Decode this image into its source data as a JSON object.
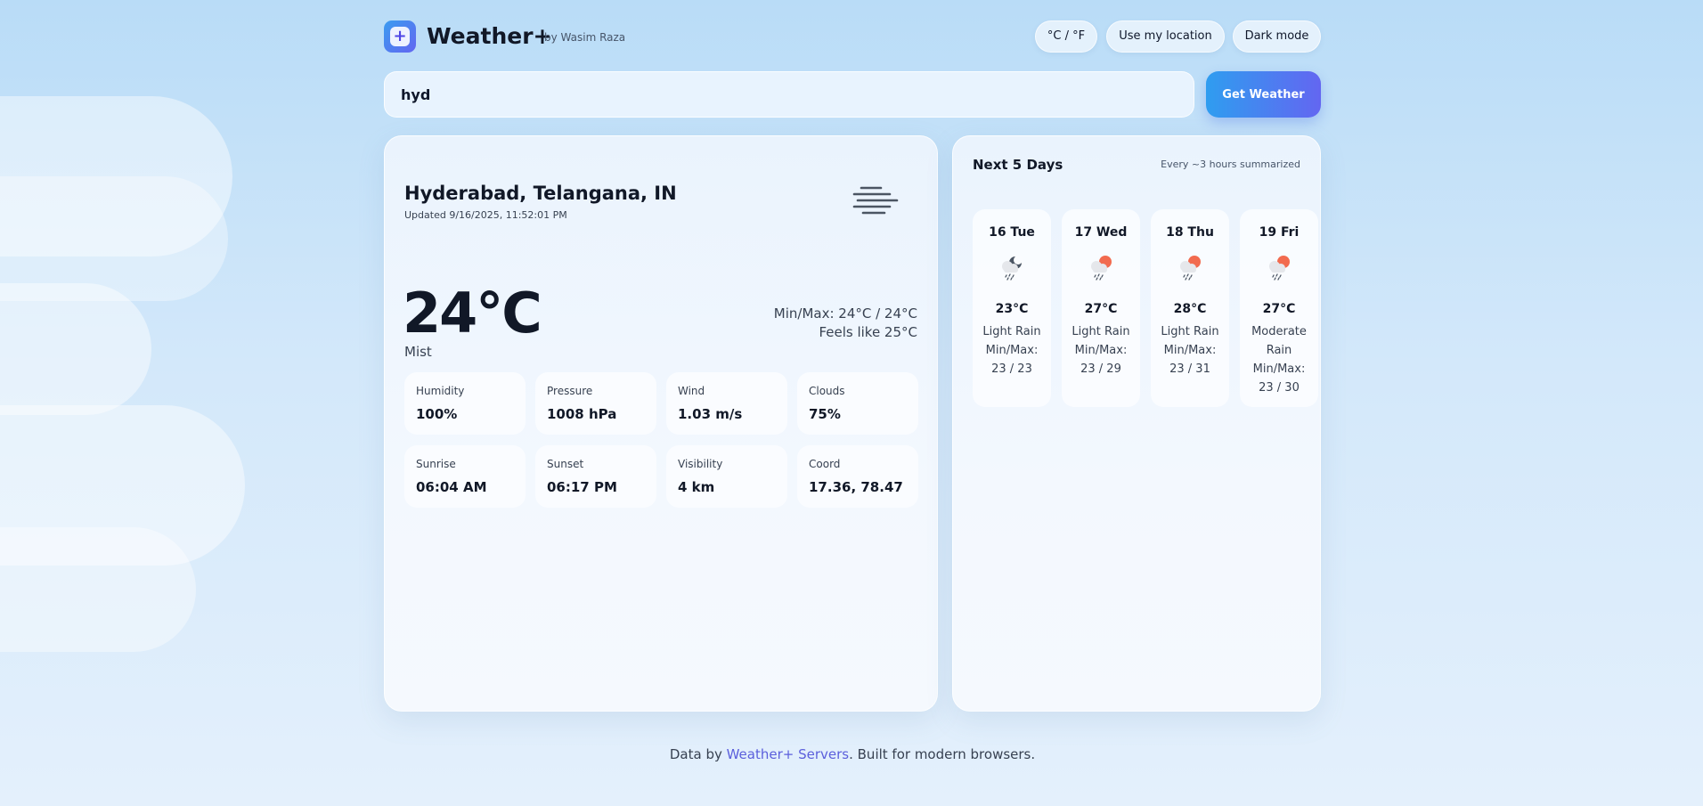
{
  "header": {
    "logo_glyph": "+",
    "title": "Weather+",
    "author": "by Wasim Raza",
    "unit_toggle": "°C / °F",
    "location_button": "Use my location",
    "dark_mode_button": "Dark mode"
  },
  "search": {
    "value": "hyd",
    "button_label": "Get Weather"
  },
  "current": {
    "city": "Hyderabad, Telangana, IN",
    "updated": "Updated 9/16/2025, 11:52:01 PM",
    "icon": "mist-icon",
    "temperature": "24°C",
    "condition": "Mist",
    "min_max": "Min/Max: 24°C / 24°C",
    "feels_like": "Feels like 25°C",
    "stats": [
      {
        "label": "Humidity",
        "value": "100%"
      },
      {
        "label": "Pressure",
        "value": "1008 hPa"
      },
      {
        "label": "Wind",
        "value": "1.03 m/s"
      },
      {
        "label": "Clouds",
        "value": "75%"
      },
      {
        "label": "Sunrise",
        "value": "06:04 AM"
      },
      {
        "label": "Sunset",
        "value": "06:17 PM"
      },
      {
        "label": "Visibility",
        "value": "4 km"
      },
      {
        "label": "Coord",
        "value": "17.36, 78.47"
      }
    ]
  },
  "forecast": {
    "title": "Next 5 Days",
    "subtitle": "Every ~3 hours summarized",
    "days": [
      {
        "day": "16 Tue",
        "icon": "night-rain-icon",
        "temp": "23°C",
        "desc": "Light Rain",
        "minmax_label": "Min/Max:",
        "minmax": "23 / 23"
      },
      {
        "day": "17 Wed",
        "icon": "day-rain-icon",
        "temp": "27°C",
        "desc": "Light Rain",
        "minmax_label": "Min/Max:",
        "minmax": "23 / 29"
      },
      {
        "day": "18 Thu",
        "icon": "day-rain-icon",
        "temp": "28°C",
        "desc": "Light Rain",
        "minmax_label": "Min/Max:",
        "minmax": "23 / 31"
      },
      {
        "day": "19 Fri",
        "icon": "day-rain-icon",
        "temp": "27°C",
        "desc": "Moderate Rain",
        "minmax_label": "Min/Max:",
        "minmax": "23 / 30"
      }
    ]
  },
  "footer": {
    "prefix": "Data by ",
    "link": "Weather+ Servers",
    "suffix": ". Built for modern browsers."
  },
  "colors": {
    "accent": "#6366f1",
    "accent_blue": "#2f9df0",
    "sun_orange": "#f26b4f",
    "moon_dark": "#4b5563"
  }
}
